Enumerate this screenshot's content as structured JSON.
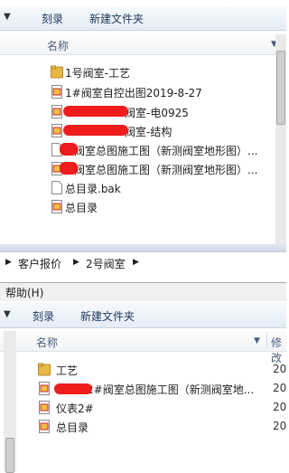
{
  "top": {
    "toolbar": {
      "carve_label": "刻录",
      "new_folder_label": "新建文件夹"
    },
    "column": {
      "name_label": "名称"
    },
    "files": [
      {
        "name": "1号阀室-工艺",
        "icon": "folder-icon"
      },
      {
        "name": "1#阀室自控出图2019-8-27",
        "icon": "cad-file-icon"
      },
      {
        "name": "阀室-电0925",
        "icon": "cad-file-icon"
      },
      {
        "name": "阀室-结构",
        "icon": "cad-file-icon"
      },
      {
        "name": "阀室总图施工图（新测阀室地形图）...",
        "icon": "blank-file-icon"
      },
      {
        "name": "阀室总图施工图（新测阀室地形图）...",
        "icon": "cad-file-icon"
      },
      {
        "name": "总目录.bak",
        "icon": "blank-file-icon"
      },
      {
        "name": "总目录",
        "icon": "cad-file-icon"
      }
    ]
  },
  "breadcrumb": {
    "items": [
      "客户报价",
      "2号阀室"
    ]
  },
  "bottom": {
    "menu": {
      "help_label": "帮助(H)"
    },
    "toolbar": {
      "carve_label": "刻录",
      "new_folder_label": "新建文件夹"
    },
    "column": {
      "name_label": "名称",
      "modified_label": "修改"
    },
    "files": [
      {
        "name": "工艺",
        "icon": "folder-icon",
        "date": "20"
      },
      {
        "name": "2#阀室总图施工图（新测阀室地...",
        "icon": "cad-file-icon",
        "date": "20"
      },
      {
        "name": "仪表2#",
        "icon": "cad-file-icon",
        "date": "20"
      },
      {
        "name": "总目录",
        "icon": "cad-file-icon",
        "date": "20"
      }
    ]
  },
  "colors": {
    "redaction": "#ee1c1c",
    "folder": "#e8b847",
    "toolbar_text": "#1e395b"
  }
}
